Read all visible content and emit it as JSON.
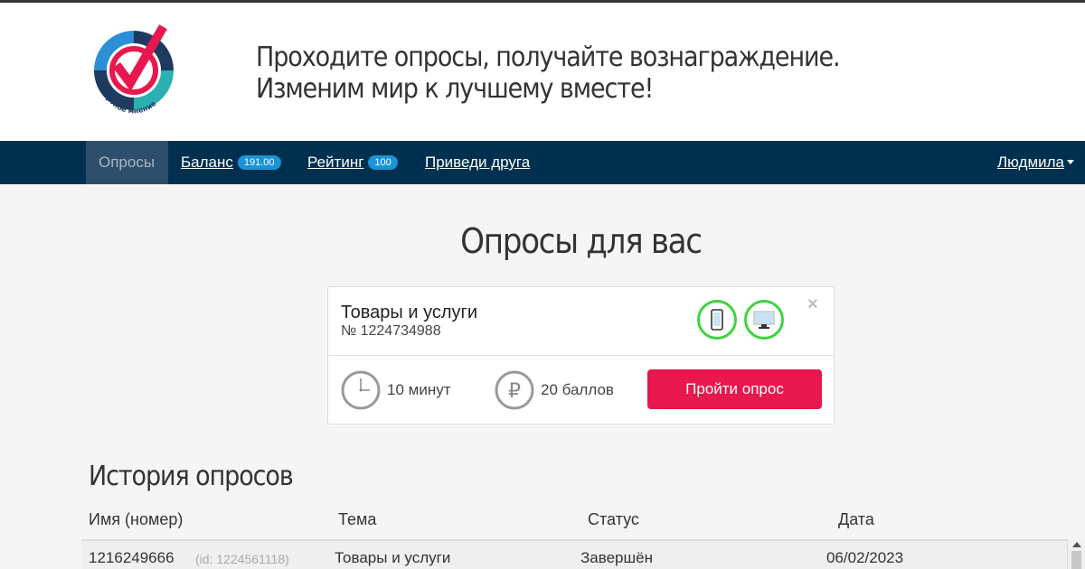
{
  "header": {
    "logo_text": "экспертное мнение",
    "tagline_line1": "Проходите опросы, получайте вознаграждение.",
    "tagline_line2": "Изменим мир к лучшему вместе!"
  },
  "nav": {
    "items": [
      {
        "label": "Опросы",
        "active": true
      },
      {
        "label": "Баланс",
        "badge": "191.00"
      },
      {
        "label": "Рейтинг",
        "badge": "100"
      },
      {
        "label": "Приведи друга"
      }
    ],
    "user": "Людмила"
  },
  "page_title": "Опросы для вас",
  "survey_card": {
    "title": "Товары и услуги",
    "number": "№ 1224734988",
    "devices": [
      "phone-icon",
      "desktop-icon"
    ],
    "close": "×",
    "duration": "10 минут",
    "reward": "20 баллов",
    "cta": "Пройти опрос"
  },
  "history": {
    "title": "История опросов",
    "columns": [
      "Имя (номер)",
      "Тема",
      "Статус",
      "Дата"
    ],
    "rows": [
      {
        "name": "1216249666",
        "id": "(id: 1224561118)",
        "topic": "Товары и услуги",
        "status": "Завершён",
        "date": "06/02/2023"
      }
    ]
  },
  "colors": {
    "navbar": "#003050",
    "nav_active": "#2d4f6b",
    "badge": "#1a94d6",
    "cta": "#e8174d",
    "device_ring": "#3ed43e"
  }
}
